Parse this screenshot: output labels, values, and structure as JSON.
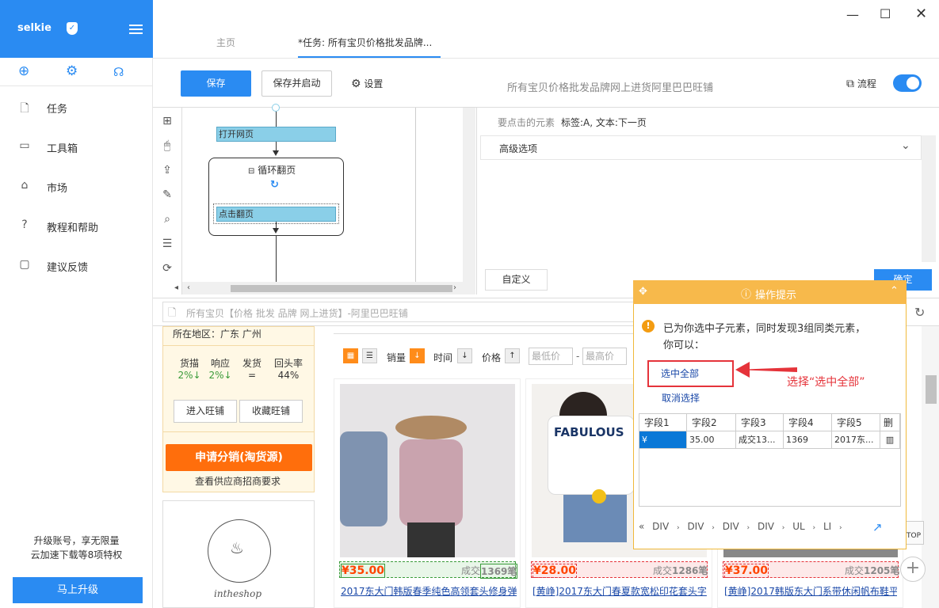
{
  "sidebar": {
    "logo": "selkie",
    "nav": [
      {
        "label": "任务",
        "icon": "file-icon"
      },
      {
        "label": "工具箱",
        "icon": "toolbox-icon"
      },
      {
        "label": "市场",
        "icon": "lock-icon"
      },
      {
        "label": "教程和帮助",
        "icon": "help-icon"
      },
      {
        "label": "建议反馈",
        "icon": "feedback-icon"
      }
    ],
    "promo_line1": "升级账号，享无限量",
    "promo_line2": "云加速下载等8项特权",
    "upgrade_label": "马上升级"
  },
  "tabs": {
    "home": "主页",
    "task": "*任务: 所有宝贝价格批发品牌..."
  },
  "toolbar": {
    "save": "保存",
    "save_start": "保存并启动",
    "settings": "设置",
    "task_title": "所有宝贝价格批发品牌网上进货阿里巴巴旺铺",
    "flow": "流程"
  },
  "flow": {
    "open_page": "打开网页",
    "loop": "循环翻页",
    "click_page": "点击翻页"
  },
  "element_panel": {
    "label": "要点击的元素",
    "value": "标签:A, 文本:下一页",
    "advanced": "高级选项",
    "custom": "自定义",
    "confirm": "确定"
  },
  "browser": {
    "url_text": "所有宝贝【价格 批发 品牌 网上进货】-阿里巴巴旺铺"
  },
  "shop": {
    "region": "所在地区：广东 广州",
    "stats_labels": [
      "货描",
      "响应",
      "发货",
      "回头率"
    ],
    "stats_values": [
      "2%↓",
      "2%↓",
      "=",
      "44%"
    ],
    "enter_shop": "进入旺铺",
    "collect_shop": "收藏旺铺",
    "apply": "申请分销(淘货源)",
    "supplier": "查看供应商招商要求",
    "logo_text": "intheshop"
  },
  "sort": {
    "sales": "销量",
    "time": "时间",
    "price": "价格",
    "min_price": "最低价",
    "max_price": "最高价",
    "dash": "-"
  },
  "products": [
    {
      "price": "¥35.00",
      "deal_label": "成交",
      "deal_count": "1369笔",
      "title": "2017东大门韩版春季纯色高领套头修身弹"
    },
    {
      "price": "¥28.00",
      "deal_label": "成交",
      "deal_count": "1286笔",
      "title": "[黄峥]2017东大门春夏款宽松印花套头字"
    },
    {
      "price": "¥37.00",
      "deal_label": "成交",
      "deal_count": "1205笔",
      "title": "[黄峥]2017韩版东大门系带休闲帆布鞋平"
    }
  ],
  "product_image_text": "FABULOUS",
  "popup": {
    "title": "操作提示",
    "message": "已为你选中子元素，同时发现3组同类元素，你可以：",
    "select_all": "选中全部",
    "cancel": "取消选择",
    "hint": "选择“选中全部”",
    "columns": [
      "字段1",
      "字段2",
      "字段3",
      "字段4",
      "字段5",
      "删"
    ],
    "row": [
      "¥",
      "35.00",
      "成交13...",
      "1369",
      "2017东..."
    ],
    "path": [
      "DIV",
      "DIV",
      "DIV",
      "DIV",
      "UL",
      "LI"
    ]
  },
  "top_label": "TOP",
  "colors": {
    "accent": "#2a8bf2",
    "orange": "#ff6e0c",
    "popup": "#f7b94b",
    "red": "#e5333a"
  }
}
